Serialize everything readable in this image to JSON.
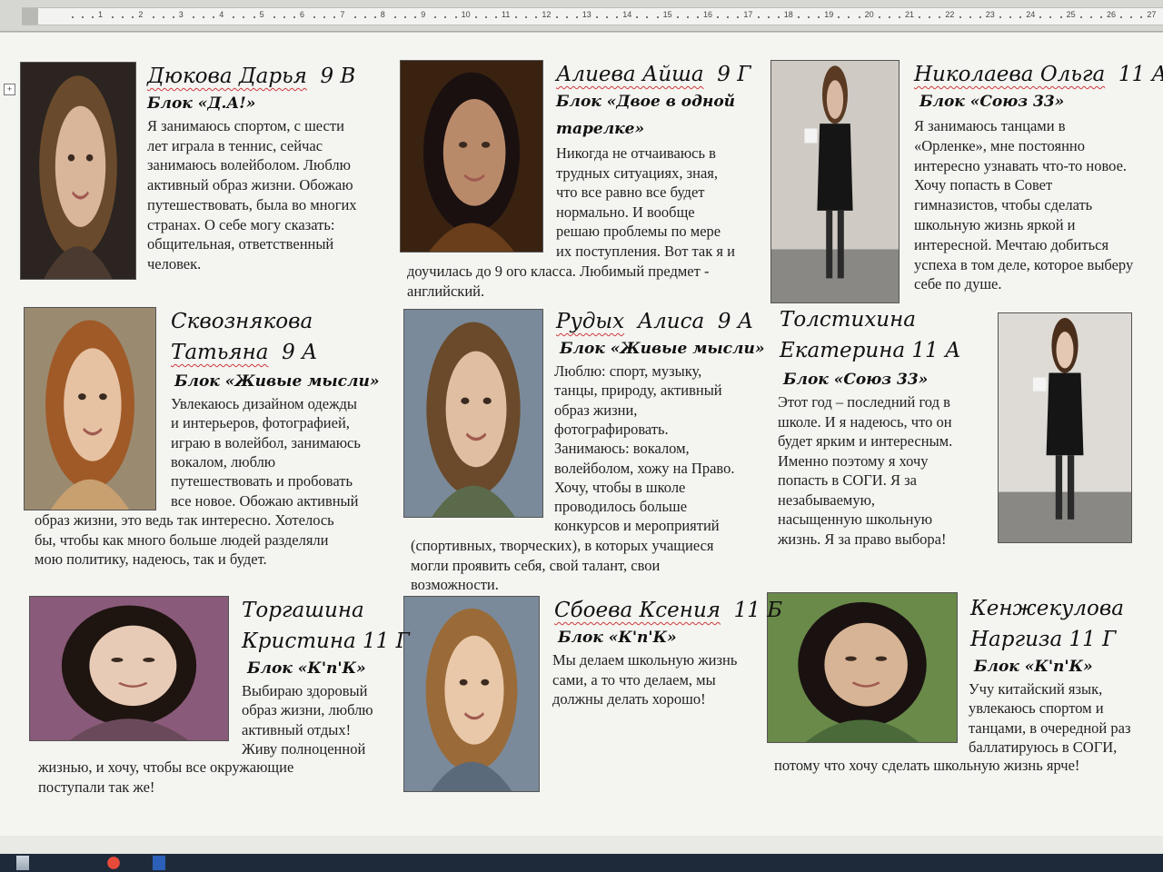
{
  "ruler": {
    "ticks": [
      "1",
      "2",
      "3",
      "4",
      "5",
      "6",
      "7",
      "8",
      "9",
      "10",
      "11",
      "12",
      "13",
      "14",
      "15",
      "16",
      "17",
      "18",
      "19",
      "20",
      "21",
      "22",
      "23",
      "24",
      "25",
      "26",
      "27"
    ]
  },
  "students": {
    "s1": {
      "name_1": "Дюкова Дарья",
      "name_2": "9 В",
      "bloc": "Блок «Д.А!»",
      "lines": [
        "Я занимаюсь спортом, с шести",
        "лет играла в теннис, сейчас",
        "занимаюсь волейболом. Люблю",
        "активный образ жизни. Обожаю",
        "путешествовать, была во многих",
        "странах. О себе могу сказать:",
        "общительная, ответственный",
        "человек."
      ]
    },
    "s2": {
      "name_1": "Алиева Айша",
      "name_2": "9 Г",
      "bloc_1": "Блок «Двое в одной",
      "bloc_2": "тарелке»",
      "lines": [
        "Никогда не отчаиваюсь в",
        "трудных ситуациях, зная,",
        "что все равно все будет",
        "нормально. И вообще",
        "решаю проблемы по мере",
        "их поступления. Вот так я и"
      ],
      "lines_wide": [
        "доучилась до 9 ого класса. Любимый предмет -",
        "английский."
      ]
    },
    "s3": {
      "name_1": "Николаева Ольга",
      "name_2": "11 А",
      "bloc": "Блок «Союз 33»",
      "lines": [
        "Я занимаюсь танцами в",
        "«Орленке», мне постоянно",
        "интересно узнавать что-то новое.",
        "Хочу попасть в Совет",
        "гимназистов, чтобы сделать",
        "школьную жизнь яркой и",
        "интересной. Мечтаю добиться",
        "успеха в том деле, которое выберу",
        "себе по душе."
      ]
    },
    "s4": {
      "name_1": "Сквознякова",
      "name_2": "Татьяна",
      "name_3": "9 А",
      "bloc": "Блок «Живые мысли»",
      "lines": [
        "Увлекаюсь дизайном одежды",
        "и интерьеров, фотографией,",
        "играю в волейбол, занимаюсь",
        "вокалом, люблю",
        "путешествовать и пробовать",
        "все новое. Обожаю активный"
      ],
      "lines_wide": [
        "образ жизни, это ведь так интересно. Хотелось",
        "бы, чтобы как много больше людей разделяли",
        "мою политику, надеюсь, так и будет."
      ]
    },
    "s5": {
      "name_1": "Рудых",
      "name_2": "Алиса",
      "name_3": "9 А",
      "bloc": "Блок «Живые мысли»",
      "lines": [
        "Люблю: спорт, музыку,",
        "танцы, природу, активный",
        "образ жизни,",
        "фотографировать.",
        "Занимаюсь: вокалом,",
        "волейболом, хожу на Право.",
        "Хочу, чтобы в школе",
        "проводилось больше",
        "конкурсов и мероприятий"
      ],
      "lines_wide": [
        "(спортивных, творческих), в которых учащиеся",
        "могли проявить себя, свой талант, свои",
        "возможности."
      ]
    },
    "s6": {
      "name_1": "Толстихина",
      "name_2": "Екатерина",
      "name_3": "11 А",
      "bloc": "Блок «Союз 33»",
      "lines": [
        "Этот год – последний год в",
        "школе. И я надеюсь, что он",
        "будет ярким и интересным.",
        "Именно поэтому я хочу",
        "попасть в СОГИ. Я за",
        "незабываемую,",
        "насыщенную школьную",
        "жизнь. Я за право выбора!"
      ]
    },
    "s7": {
      "name_1": "Торгашина",
      "name_2": "Кристина",
      "name_3": "11 Г",
      "bloc": "Блок «К'п'К»",
      "lines": [
        "Выбираю здоровый",
        "образ жизни, люблю",
        "активный отдых!",
        "Живу полноценной"
      ],
      "lines_wide": [
        "жизнью, и хочу, чтобы все окружающие",
        "поступали так же!"
      ]
    },
    "s8": {
      "name_1": "Сбоева Ксения",
      "name_2": "11 Б",
      "bloc": "Блок «К'п'К»",
      "lines": [
        "Мы делаем школьную жизнь",
        "сами, а то что делаем, мы",
        "должны делать хорошо!"
      ]
    },
    "s9": {
      "name_1": "Кенжекулова",
      "name_2": "Наргиза",
      "name_3": "11 Г",
      "bloc": "Блок «К'п'К»",
      "lines": [
        "Учу китайский язык,",
        "увлекаюсь спортом и",
        "танцами, в очередной раз",
        "баллатируюсь в СОГИ,"
      ],
      "lines_wide": [
        "потому что хочу сделать школьную жизнь ярче!"
      ]
    }
  },
  "photos": [
    {
      "name": "photo-dyukova",
      "tone": "#4a3a30",
      "skin": "#d9b59a",
      "hair": "#6a4a2c",
      "bg": "#2b2420"
    },
    {
      "name": "photo-alieva",
      "tone": "#6a3e1a",
      "skin": "#b98a6a",
      "hair": "#1a1010",
      "bg": "#3a2210"
    },
    {
      "name": "photo-nikolaeva",
      "tone": "#e0ddd8",
      "skin": "#d9b9a4",
      "hair": "#5a3a22",
      "bg": "#cfcac4"
    },
    {
      "name": "photo-skvoznyakova",
      "tone": "#c8a070",
      "skin": "#e6c2a2",
      "hair": "#a05a28",
      "bg": "#9a8a70"
    },
    {
      "name": "photo-rudykh",
      "tone": "#5a6a4a",
      "skin": "#e0bea2",
      "hair": "#6a4a2a",
      "bg": "#7a8a9a"
    },
    {
      "name": "photo-tolstikhina",
      "tone": "#e2e0dc",
      "skin": "#e4c8b4",
      "hair": "#4a2e1c",
      "bg": "#dedbd6"
    },
    {
      "name": "photo-torgashina",
      "tone": "#6a4a5a",
      "skin": "#e8cbb6",
      "hair": "#1e1410",
      "bg": "#8a5a7a"
    },
    {
      "name": "photo-sboeva",
      "tone": "#5a6a7a",
      "skin": "#e8c8a8",
      "hair": "#9a6a38",
      "bg": "#7a8a9a"
    },
    {
      "name": "photo-kenzhekulova",
      "tone": "#4a6a3a",
      "skin": "#d8b496",
      "hair": "#1a1210",
      "bg": "#6a8a4a"
    }
  ],
  "colors": {
    "spell_underline": "#d03a3a",
    "page": "#f4f4f1"
  }
}
